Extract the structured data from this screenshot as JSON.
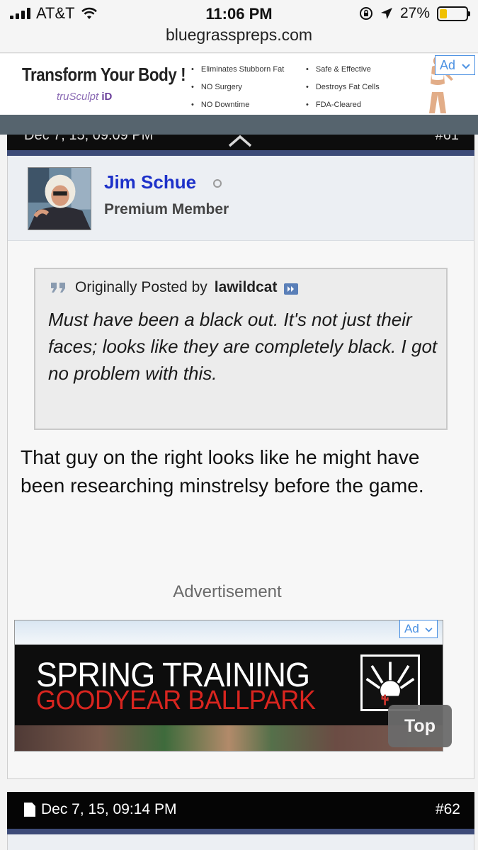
{
  "status_bar": {
    "carrier": "AT&T",
    "time": "11:06 PM",
    "battery": "27%",
    "battery_level": 0.27,
    "url": "bluegrasspreps.com"
  },
  "top_ad": {
    "title": "Transform Your Body !",
    "brand": "truSculpt",
    "brand_suffix": "iD",
    "features_col1": [
      "Eliminates Stubborn Fat",
      "NO Surgery",
      "NO Downtime"
    ],
    "features_col2": [
      "Safe & Effective",
      "Destroys Fat Cells",
      "FDA-Cleared"
    ],
    "ad_chip": "Ad"
  },
  "prev_post": {
    "clipped_date": "Dec 7, 15, 09:09 PM",
    "clipped_number": "#61"
  },
  "post": {
    "username": "Jim Schue",
    "rank": "Premium Member",
    "quote_prefix": "Originally Posted by",
    "quote_author": "lawildcat",
    "quote_text": "Must have been a black out. It's not just their faces; looks like they are completely black. I got no problem with this.",
    "body": "That guy on the right looks like he might have been researching minstrelsy before the game."
  },
  "advert": {
    "label": "Advertisement",
    "line1": "SPRING TRAINING",
    "line2": "GOODYEAR BALLPARK",
    "ad_chip": "Ad"
  },
  "top_button": "Top",
  "next_post": {
    "date": "Dec 7, 15, 09:14 PM",
    "number": "#62"
  },
  "colors": {
    "username": "#1d31c9",
    "header_strip": "#3d4b78",
    "ad_chip": "#4a90e2",
    "ballpark_red": "#d8251f"
  }
}
